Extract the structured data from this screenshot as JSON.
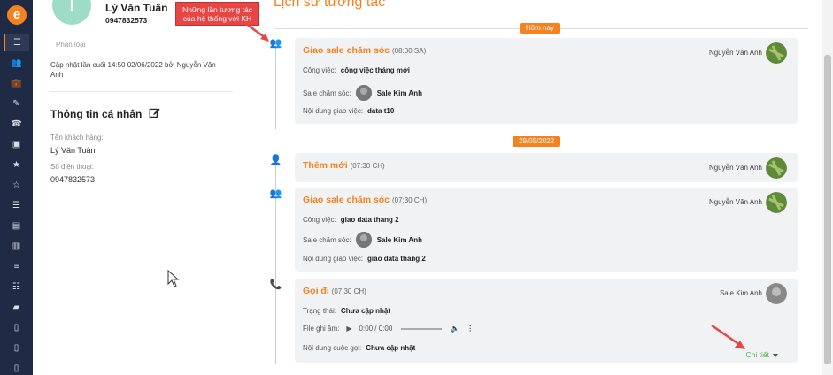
{
  "sidebar": {
    "logo": "e",
    "items": [
      {
        "icon": "list-icon",
        "glyph": "☰"
      },
      {
        "icon": "users-icon",
        "glyph": "👥"
      },
      {
        "icon": "briefcase-icon",
        "glyph": "💼"
      },
      {
        "icon": "edit-doc-icon",
        "glyph": "✎"
      },
      {
        "icon": "phone-book-icon",
        "glyph": "☎"
      },
      {
        "icon": "contact-card-icon",
        "glyph": "▣"
      },
      {
        "icon": "star-badge-icon",
        "glyph": "★"
      },
      {
        "icon": "star-icon",
        "glyph": "☆"
      },
      {
        "icon": "list-alt-icon",
        "glyph": "☰"
      },
      {
        "icon": "document-icon",
        "glyph": "▤"
      },
      {
        "icon": "chart-icon",
        "glyph": "▥"
      },
      {
        "icon": "sliders-icon",
        "glyph": "≡"
      },
      {
        "icon": "checklist-icon",
        "glyph": "☷"
      },
      {
        "icon": "inbox-icon",
        "glyph": "▰"
      },
      {
        "icon": "file-icon",
        "glyph": "▯"
      },
      {
        "icon": "file-text-icon",
        "glyph": "▯"
      },
      {
        "icon": "file-lines-icon",
        "glyph": "▯"
      }
    ],
    "active_index": 0
  },
  "customer": {
    "avatar_letter": "T",
    "name": "Lý Văn Tuân",
    "phone": "0947832573",
    "category_placeholder": "Phân loại",
    "updated_text": "Cập nhật lần cuối 14:50 02/06/2022 bởi Nguyễn Văn Anh"
  },
  "personal_info": {
    "title": "Thông tin cá nhân",
    "fields": [
      {
        "label": "Tên khách hàng:",
        "value": "Lý Văn Tuân"
      },
      {
        "label": "Số điện thoại:",
        "value": "0947832573"
      }
    ]
  },
  "timeline": {
    "title": "Lịch sử tương tác",
    "dates": [
      "Hôm nay",
      "29/05/2022"
    ],
    "cards": [
      {
        "title": "Giao sale chăm sóc",
        "time": "(08:00 SA)",
        "owner": "Nguyễn Văn Anh",
        "rows": [
          {
            "label": "Công việc:",
            "value": "công việc tháng mới"
          },
          {
            "label": "Sale chăm sóc:",
            "value": "Sale Kim Anh"
          },
          {
            "label": "Nội dung giao việc:",
            "value": "data t10"
          }
        ]
      },
      {
        "title": "Thêm mới",
        "time": "(07:30 CH)",
        "owner": "Nguyễn Văn Anh",
        "rows": []
      },
      {
        "title": "Giao sale chăm sóc",
        "time": "(07:30 CH)",
        "owner": "Nguyễn Văn Anh",
        "rows": [
          {
            "label": "Công việc:",
            "value": "giao data thang 2"
          },
          {
            "label": "Sale chăm sóc:",
            "value": "Sale Kim Anh"
          },
          {
            "label": "Nội dung giao việc:",
            "value": "giao data thang 2"
          }
        ]
      },
      {
        "title": "Gọi đi",
        "time": "(07:30 CH)",
        "owner": "Sale Kim Anh",
        "rows": [
          {
            "label": "Trạng thái:",
            "value": "Chưa cập nhật"
          },
          {
            "label": "File ghi âm:",
            "value": "0:00 / 0:00"
          },
          {
            "label": "Nội dung cuộc gọi:",
            "value": "Chưa cập nhật"
          }
        ],
        "detail_link": "Chi tiết"
      }
    ]
  },
  "annotation": {
    "callout_line1": "Những lần tương tác",
    "callout_line2": "của hệ thống với KH",
    "color": "#e84545"
  },
  "colors": {
    "accent": "#f5811f",
    "sidebar": "#1f2a44",
    "detail_link": "#4caf50"
  }
}
